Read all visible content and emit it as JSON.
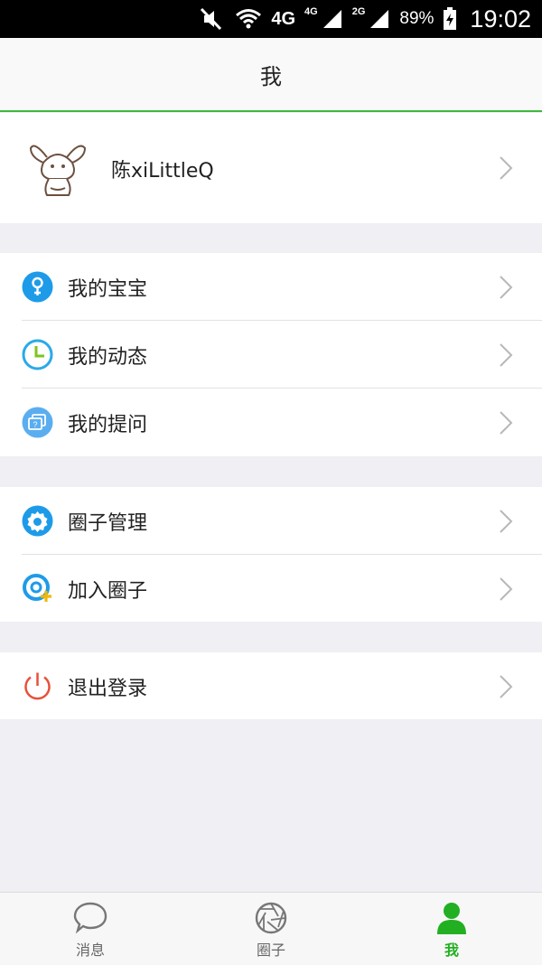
{
  "status_bar": {
    "network_primary": "4G",
    "network_secondary_1": "4G",
    "network_secondary_2": "2G",
    "battery": "89%",
    "time": "19:02"
  },
  "header": {
    "title": "我"
  },
  "profile": {
    "name": "陈xiLittleQ"
  },
  "groups": [
    {
      "items": [
        {
          "label": "我的宝宝",
          "icon": "baby-icon"
        },
        {
          "label": "我的动态",
          "icon": "clock-icon"
        },
        {
          "label": "我的提问",
          "icon": "question-icon"
        }
      ]
    },
    {
      "items": [
        {
          "label": "圈子管理",
          "icon": "gear-icon"
        },
        {
          "label": "加入圈子",
          "icon": "join-circle-icon"
        }
      ]
    },
    {
      "items": [
        {
          "label": "退出登录",
          "icon": "power-icon"
        }
      ]
    }
  ],
  "tabbar": {
    "tabs": [
      {
        "label": "消息",
        "icon": "chat-bubble-icon",
        "active": false
      },
      {
        "label": "圈子",
        "icon": "aperture-icon",
        "active": false
      },
      {
        "label": "我",
        "icon": "person-icon",
        "active": true
      }
    ]
  },
  "colors": {
    "accent_green": "#22b022",
    "blue_icon": "#1e9be8",
    "power_red": "#e8503a"
  }
}
